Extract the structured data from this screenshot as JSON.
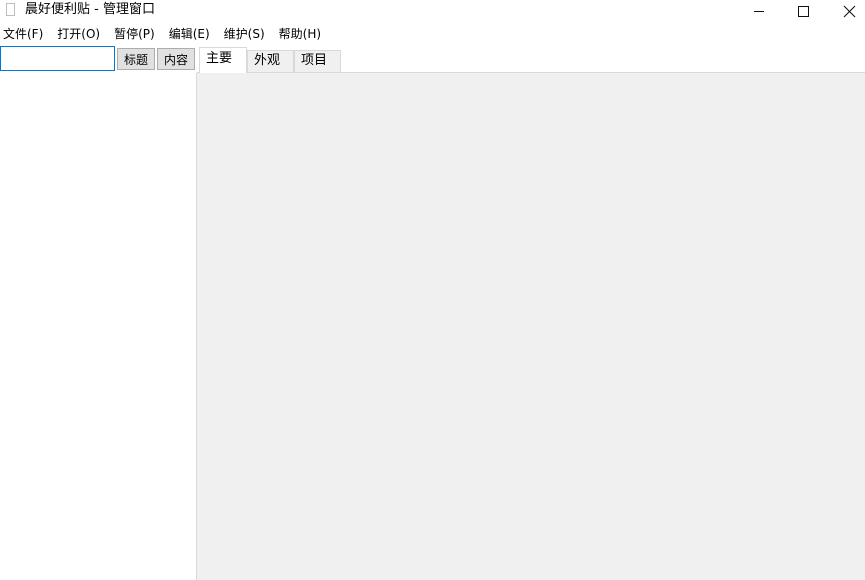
{
  "window": {
    "title": "晨好便利贴 - 管理窗口",
    "minimize_icon": "minimize-icon",
    "maximize_icon": "maximize-icon",
    "close_icon": "close-icon"
  },
  "menu": [
    {
      "label": "文件(F)"
    },
    {
      "label": "打开(O)"
    },
    {
      "label": "暂停(P)"
    },
    {
      "label": "编辑(E)"
    },
    {
      "label": "维护(S)"
    },
    {
      "label": "帮助(H)"
    }
  ],
  "search": {
    "value": "",
    "title_button": "标题",
    "content_button": "内容"
  },
  "tabs": [
    {
      "label": "主要",
      "active": true
    },
    {
      "label": "外观",
      "active": false
    },
    {
      "label": "项目",
      "active": false
    }
  ],
  "colors": {
    "focus_border": "#0078d7",
    "panel_bg": "#f0f0f0",
    "button_bg": "#e1e1e1"
  }
}
